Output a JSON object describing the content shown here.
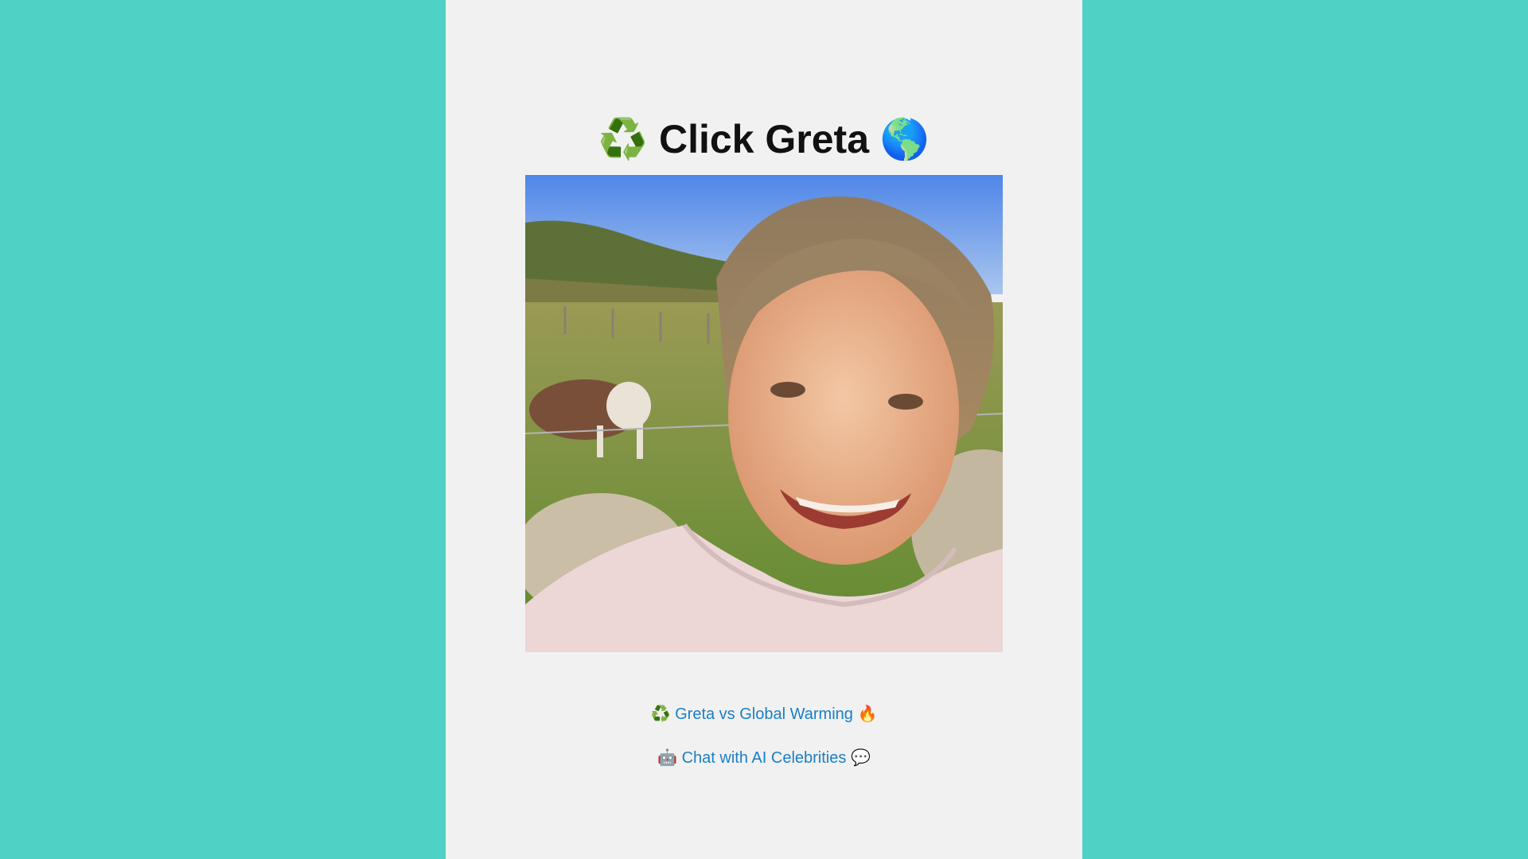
{
  "page": {
    "background_color": "#4fd1c5",
    "panel_color": "#f1f1f1"
  },
  "title": {
    "icon_left": "♻️",
    "text": "Click Greta",
    "icon_right": "🌎"
  },
  "photo": {
    "icon": "portrait-photo"
  },
  "links": [
    {
      "icon_left": "♻️",
      "label": "Greta vs Global Warming",
      "icon_right": "🔥"
    },
    {
      "icon_left": "🤖",
      "label": "Chat with AI Celebrities",
      "icon_right": "💬"
    }
  ],
  "colors": {
    "link": "#1a7fc4",
    "title": "#111111"
  }
}
